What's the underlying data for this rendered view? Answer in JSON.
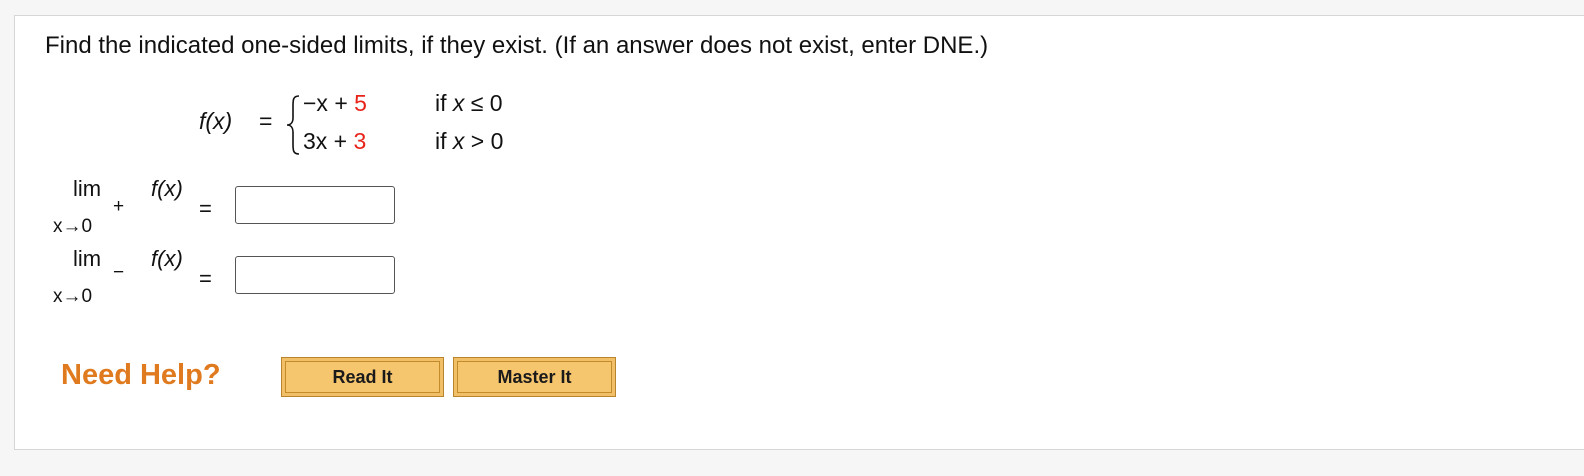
{
  "question": {
    "prompt": "Find the indicated one-sided limits, if they exist. (If an answer does not exist, enter DNE.)"
  },
  "function": {
    "label": "f(x)",
    "equals": "=",
    "brace": "{",
    "cases": [
      {
        "expr_text": "−x + ",
        "expr_const": "5",
        "condition_prefix": "if ",
        "condition_var": "x",
        "condition_rest": " ≤ 0"
      },
      {
        "expr_text": "3x + ",
        "expr_const": "3",
        "condition_prefix": "if ",
        "condition_var": "x",
        "condition_rest": " > 0"
      }
    ]
  },
  "limits": [
    {
      "lim": "lim",
      "func": "f(x)",
      "approach": "x→0",
      "side": "+",
      "equals": "=",
      "answer": ""
    },
    {
      "lim": "lim",
      "func": "f(x)",
      "approach": "x→0",
      "side": "−",
      "equals": "=",
      "answer": ""
    }
  ],
  "help": {
    "label": "Need Help?",
    "read_it": "Read It",
    "master_it": "Master It"
  },
  "colors": {
    "constant_highlight": "#e8231a",
    "need_help": "#e07a1f",
    "button_fill": "#f6c66f"
  }
}
